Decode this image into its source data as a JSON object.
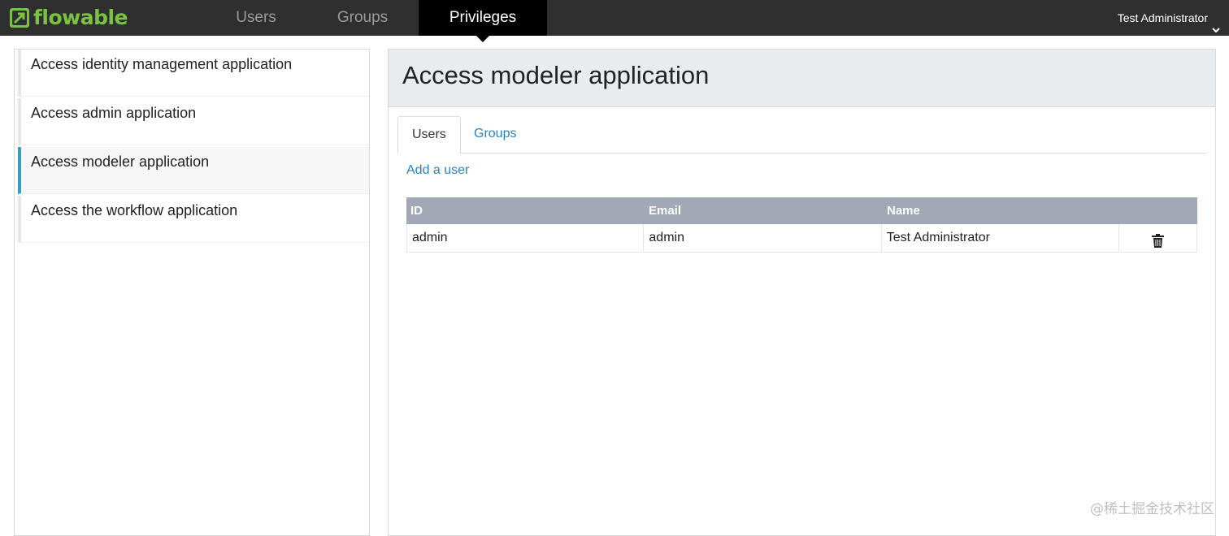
{
  "brand": {
    "name": "flowable",
    "color": "#7cc242"
  },
  "nav": {
    "users": "Users",
    "groups": "Groups",
    "privileges": "Privileges",
    "user_menu": "Test Administrator"
  },
  "sidebar": {
    "items": [
      {
        "label": "Access identity management application",
        "active": false
      },
      {
        "label": "Access admin application",
        "active": false
      },
      {
        "label": "Access modeler application",
        "active": true
      },
      {
        "label": "Access the workflow application",
        "active": false
      }
    ]
  },
  "main": {
    "title": "Access modeler application",
    "tabs": [
      {
        "label": "Users",
        "active": true
      },
      {
        "label": "Groups",
        "active": false
      }
    ],
    "add_link": "Add a user",
    "table": {
      "headers": [
        "ID",
        "Email",
        "Name"
      ],
      "rows": [
        {
          "id": "admin",
          "email": "admin",
          "name": "Test Administrator"
        }
      ]
    }
  },
  "watermark": "@稀土掘金技术社区",
  "icons": {
    "logo": "flowable-logo-icon",
    "user_menu": "chevron-down-icon",
    "delete": "trash-icon"
  },
  "colors": {
    "navbar": "#2f2f2f",
    "active_nav": "#000000",
    "link": "#2a83c1",
    "active_accent": "#3a9ec1",
    "table_header": "#a2a9b6"
  }
}
